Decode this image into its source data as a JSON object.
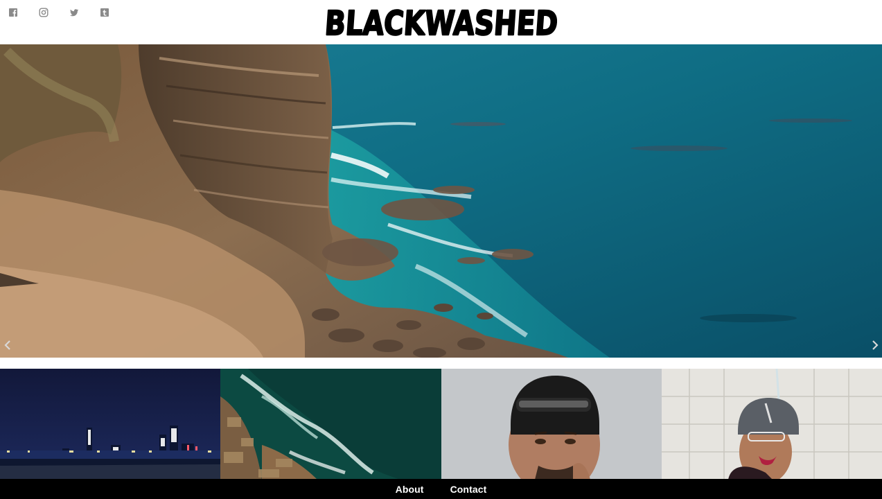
{
  "site": {
    "logo_text": "BLACKWASHED"
  },
  "social": [
    {
      "name": "facebook-icon"
    },
    {
      "name": "instagram-icon"
    },
    {
      "name": "twitter-icon"
    },
    {
      "name": "tumblr-icon"
    }
  ],
  "hero": {
    "prev_icon": "chevron-left-icon",
    "next_icon": "chevron-right-icon"
  },
  "footer": {
    "links": [
      {
        "label": "About"
      },
      {
        "label": "Contact"
      }
    ]
  },
  "colors": {
    "footer_bg": "#000000",
    "ocean": "#0e6e83",
    "cliff": "#8a6a4a"
  }
}
